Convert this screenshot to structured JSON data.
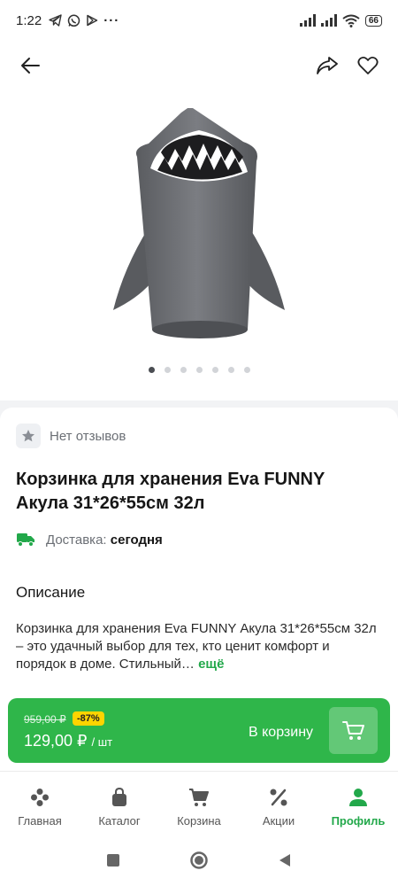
{
  "status_bar": {
    "time": "1:22",
    "battery": "66",
    "app_icons": [
      "telegram-icon",
      "whatsapp-icon",
      "play-icon",
      "more-dots-icon"
    ]
  },
  "header": {
    "back_icon": "arrow-left-icon",
    "share_icon": "share-icon",
    "favorite_icon": "heart-icon"
  },
  "gallery": {
    "image_count": 7,
    "active_index": 0
  },
  "product": {
    "reviews_label": "Нет отзывов",
    "title": "Корзинка для хранения Eva FUNNY Акула 31*26*55см 32л",
    "delivery_label": "Доставка:",
    "delivery_value": "сегодня",
    "description_heading": "Описание",
    "description_text": "Корзинка для хранения Eva FUNNY Акула 31*26*55см 32л – это удачный выбор для тех, кто ценит комфорт и порядок в доме. Стильный…",
    "more_label": "ещё"
  },
  "cart_bar": {
    "old_price": "959,00 ₽",
    "discount": "-87%",
    "price": "129,00 ₽",
    "unit": "/ шт",
    "add_label": "В корзину"
  },
  "bottom_nav": [
    {
      "label": "Главная",
      "icon": "home-icon",
      "active": false
    },
    {
      "label": "Каталог",
      "icon": "catalog-bag-icon",
      "active": false
    },
    {
      "label": "Корзина",
      "icon": "cart-icon",
      "active": false
    },
    {
      "label": "Акции",
      "icon": "percent-icon",
      "active": false
    },
    {
      "label": "Профиль",
      "icon": "profile-icon",
      "active": true
    }
  ],
  "colors": {
    "brand_green": "#2fb64a",
    "discount_yellow": "#ffd400"
  }
}
